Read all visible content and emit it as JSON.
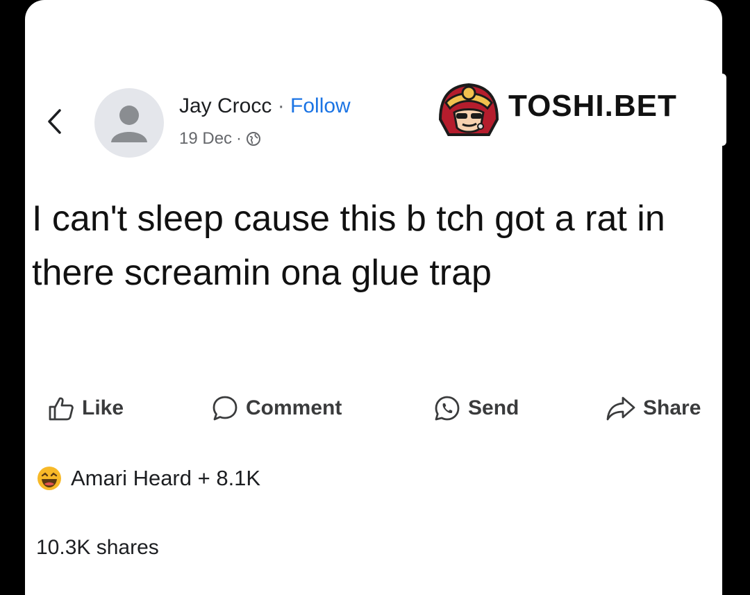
{
  "post": {
    "author": "Jay Crocc",
    "separator": " · ",
    "follow_label": "Follow",
    "date": "19 Dec",
    "meta_separator": "·",
    "text": "I can't sleep cause this b tch got a rat in there screamin ona glue trap",
    "reactions_text": "Amari Heard + 8.1K",
    "shares_text": "10.3K shares"
  },
  "actions": {
    "like": "Like",
    "comment": "Comment",
    "send": "Send",
    "share": "Share"
  },
  "watermark": {
    "brand": "TOSHI.BET"
  },
  "icons": {
    "back": "chevron-left-icon",
    "privacy": "globe-icon",
    "like": "thumbs-up-icon",
    "comment": "comment-bubble-icon",
    "send": "whatsapp-icon",
    "share": "share-arrow-icon",
    "reaction": "haha-emoji-icon"
  },
  "colors": {
    "link": "#1b74e4",
    "text": "#1c1e21",
    "muted": "#65676b",
    "background": "#000000"
  }
}
